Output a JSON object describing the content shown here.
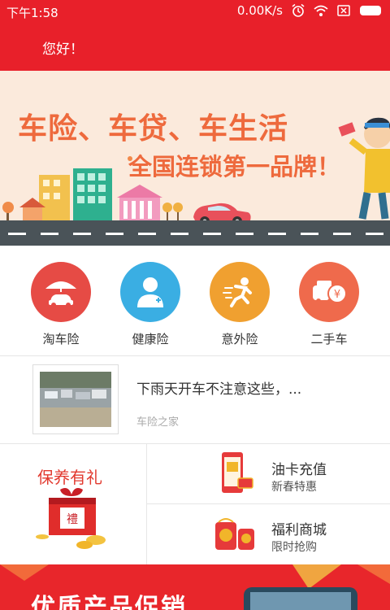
{
  "status_bar": {
    "time": "下午1:58",
    "speed": "0.00K/s",
    "icons": [
      "alarm-icon",
      "wifi-icon",
      "sim-icon",
      "battery-icon"
    ]
  },
  "header": {
    "greeting": "您好！"
  },
  "banner": {
    "headline": "车险、车贷、车生活",
    "subline": "全国连锁第一品牌！"
  },
  "categories": [
    {
      "label": "淘车险",
      "icon": "car-umbrella-icon",
      "color": "#e64b45"
    },
    {
      "label": "健康险",
      "icon": "person-health-icon",
      "color": "#3aaee3"
    },
    {
      "label": "意外险",
      "icon": "running-man-icon",
      "color": "#f0a030"
    },
    {
      "label": "二手车",
      "icon": "car-yuan-icon",
      "color": "#ef6a4c"
    }
  ],
  "news": {
    "title": "下雨天开车不注意这些，...",
    "source": "车险之家"
  },
  "promo": {
    "left_title": "保养有礼",
    "items": [
      {
        "title": "油卡充值",
        "subtitle": "新春特惠",
        "icon": "phone-card-icon"
      },
      {
        "title": "福利商城",
        "subtitle": "限时抢购",
        "icon": "gift-bags-icon"
      }
    ]
  },
  "bottom_banner": {
    "text": "优质产品促销"
  },
  "colors": {
    "primary_red": "#e8202a",
    "orange_text": "#ee6a3d"
  }
}
